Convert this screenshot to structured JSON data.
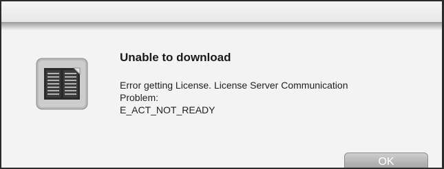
{
  "dialog": {
    "title": "Unable to download",
    "message_lines": [
      "Error getting License. License Server Communication",
      "Problem:",
      "E_ACT_NOT_READY"
    ],
    "ok_label": "OK",
    "icon": "book-icon"
  },
  "colors": {
    "button_top": "#cfcfcf",
    "button_bottom": "#9d9d9d",
    "dialog_background": "#f3f3f3"
  }
}
